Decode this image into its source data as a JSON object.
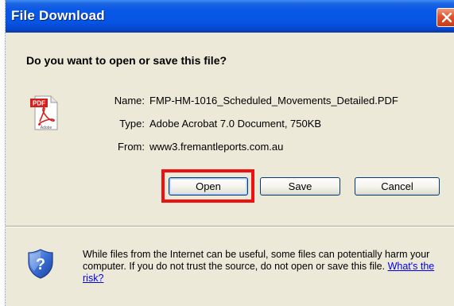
{
  "window": {
    "title": "File Download",
    "close_glyph": "×"
  },
  "dialog": {
    "question": "Do you want to open or save this file?",
    "file_icon_label": "PDF",
    "file_icon_caption": "Adobe",
    "fields": {
      "name_label": "Name:",
      "name_value": "FMP-HM-1016_Scheduled_Movements_Detailed.PDF",
      "type_label": "Type:",
      "type_value": "Adobe Acrobat 7.0 Document, 750KB",
      "from_label": "From:",
      "from_value": "www3.fremantleports.com.au"
    },
    "buttons": {
      "open_label": "Open",
      "save_label": "Save",
      "cancel_label": "Cancel"
    },
    "warning": {
      "text": "While files from the Internet can be useful, some files can potentially harm your computer. If you do not trust the source, do not open or save this file.",
      "link_text": "What's the risk?"
    }
  },
  "colors": {
    "titlebar": "#0554e3",
    "highlight": "#ee1111",
    "dialog_bg": "#ece9d8",
    "link": "#0000ee"
  },
  "icons": {
    "file_icon": "pdf-file-icon",
    "security_icon": "shield-question-icon",
    "close_icon": "close-icon"
  }
}
